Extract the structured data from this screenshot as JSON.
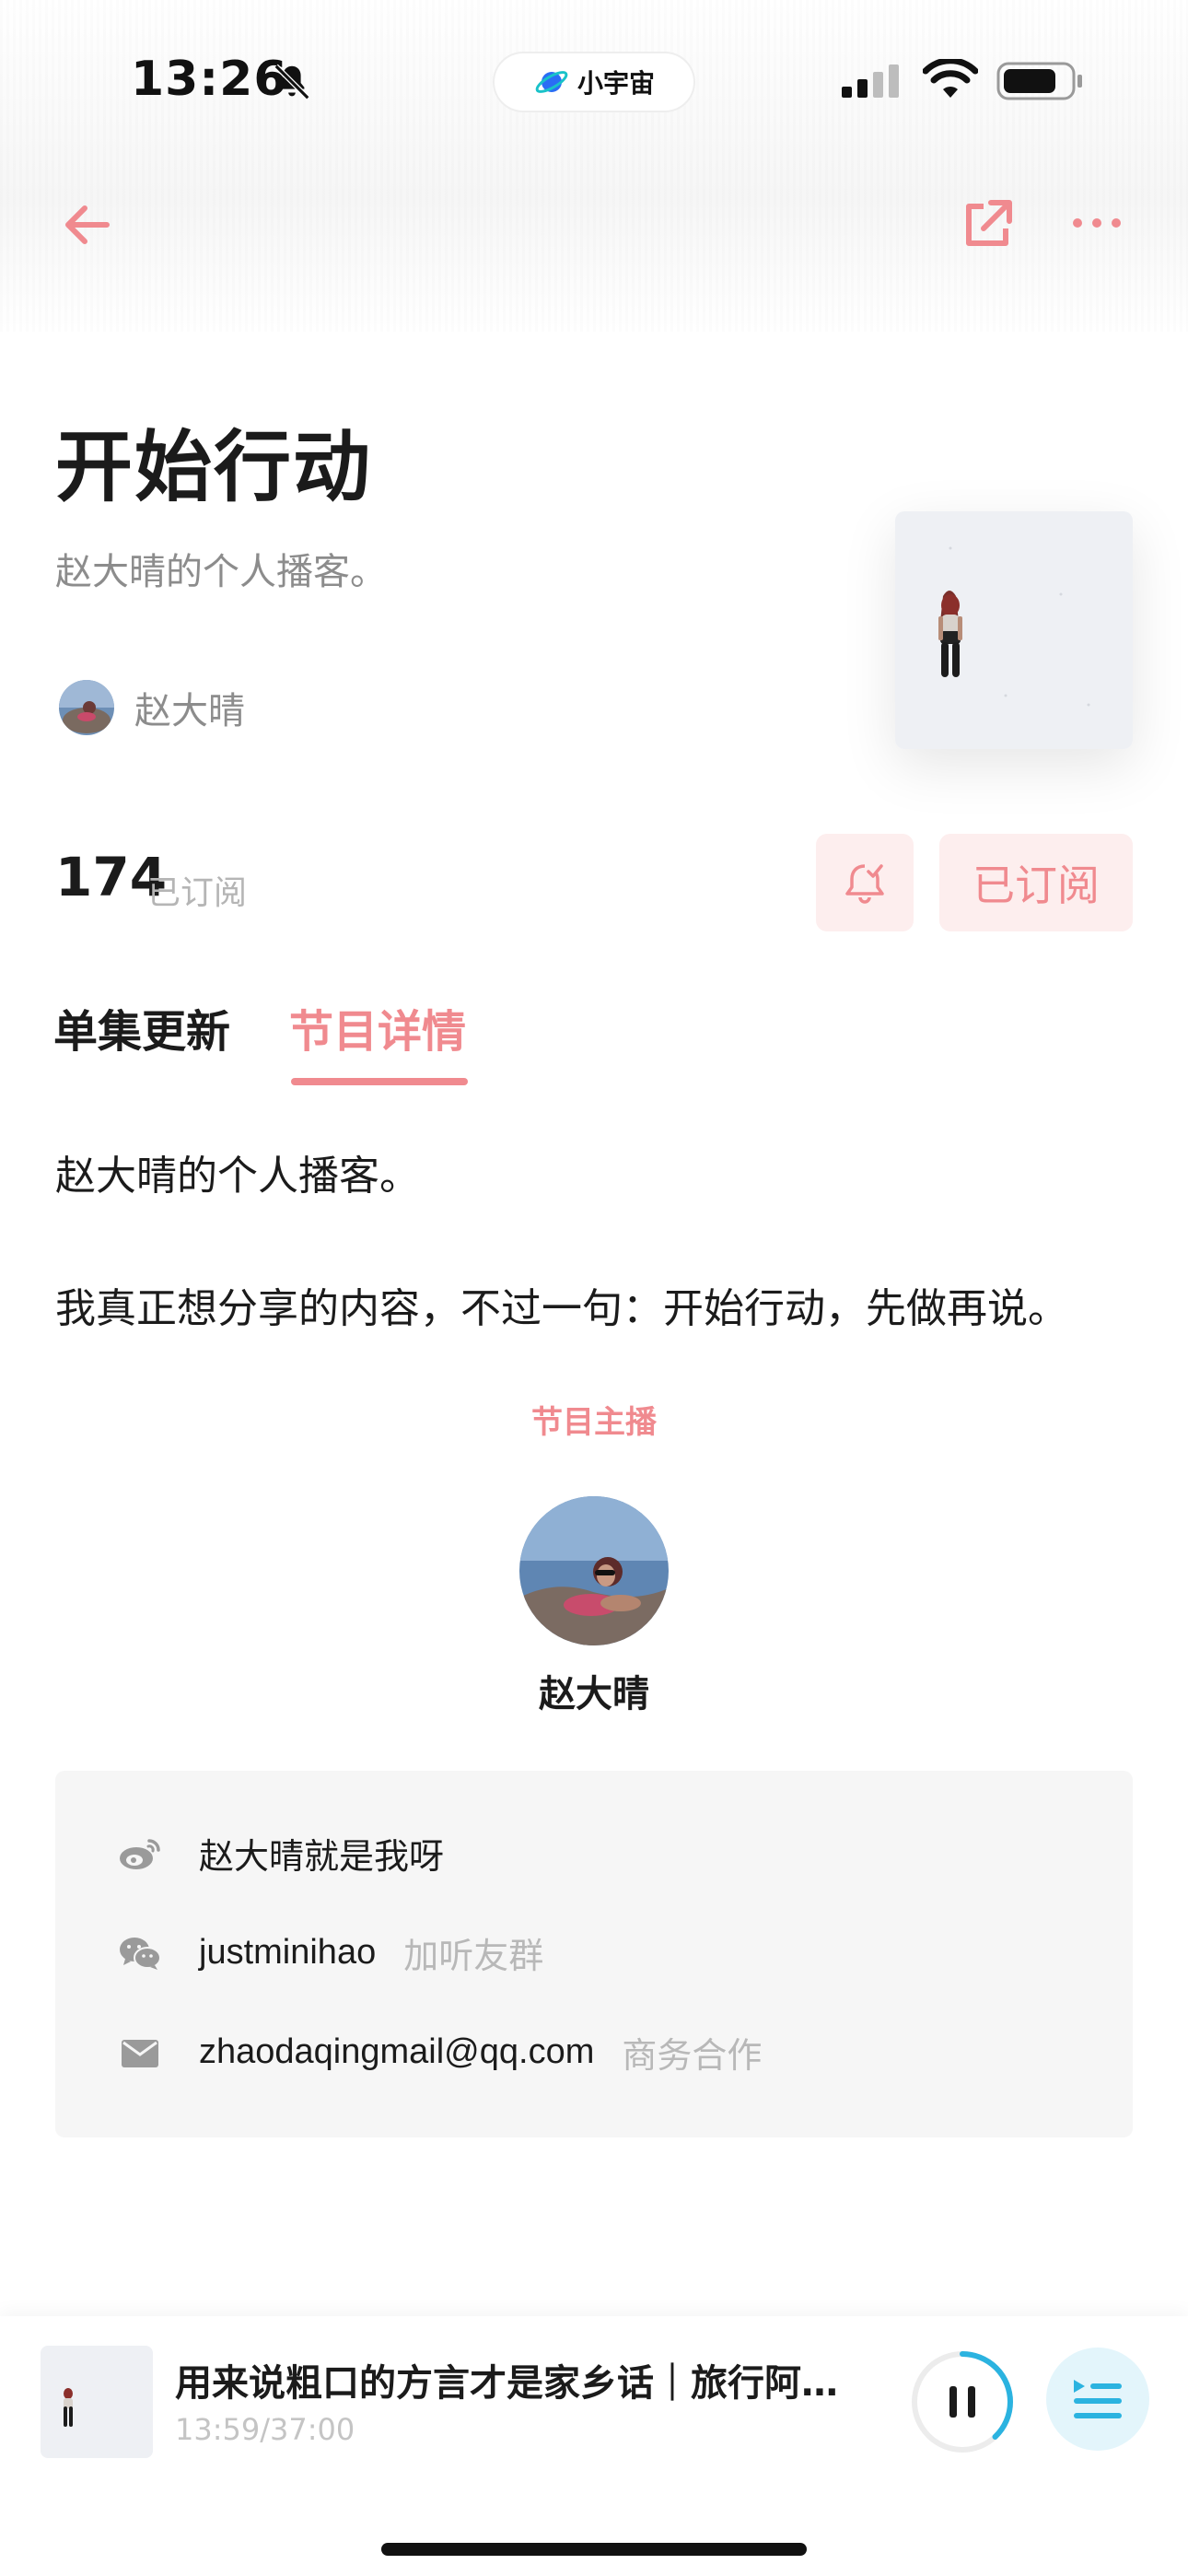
{
  "status_bar": {
    "time": "13:26",
    "island_label": "小宇宙",
    "icons": [
      "bell-off-icon",
      "planet-icon",
      "signal-icon",
      "wifi-icon",
      "battery-icon"
    ]
  },
  "nav": {
    "icons": [
      "back-arrow-icon",
      "share-icon",
      "more-icon"
    ]
  },
  "podcast": {
    "title": "开始行动",
    "subtitle": "赵大晴的个人播客。",
    "author": "赵大晴",
    "subscriber_count": "174",
    "subscriber_label": "已订阅",
    "subscribed_button": "已订阅"
  },
  "tabs": [
    {
      "label": "单集更新",
      "active": false
    },
    {
      "label": "节目详情",
      "active": true
    }
  ],
  "description": {
    "line1": "赵大晴的个人播客。",
    "line2": "我真正想分享的内容，不过一句：开始行动，先做再说。"
  },
  "host": {
    "heading": "节目主播",
    "name": "赵大晴"
  },
  "contacts": {
    "weibo": {
      "value": "赵大晴就是我呀",
      "icon": "weibo-icon"
    },
    "wechat": {
      "value": "justminihao",
      "note": "加听友群",
      "icon": "wechat-icon"
    },
    "email": {
      "value": "zhaodaqingmail@qq.com",
      "note": "商务合作",
      "icon": "mail-icon"
    }
  },
  "player": {
    "title": "用来说粗口的方言才是家乡话｜旅行阿拉...",
    "time": "13:59/37:00",
    "progress": 0.38,
    "state": "playing"
  },
  "colors": {
    "accent": "#f08a8f",
    "accent_bg": "#fdeeee",
    "player_accent": "#2bb3e0"
  }
}
